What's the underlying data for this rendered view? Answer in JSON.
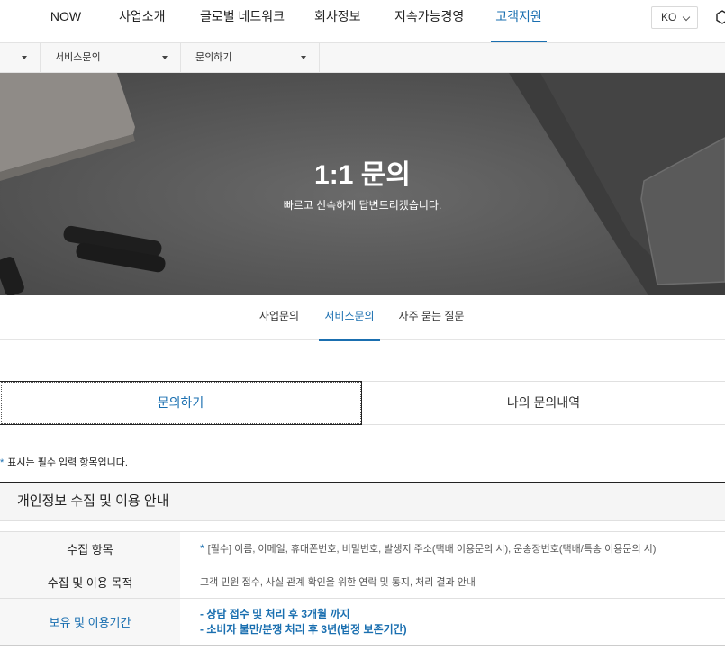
{
  "gnb": {
    "items": [
      {
        "label": "NOW"
      },
      {
        "label": "사업소개"
      },
      {
        "label": "글로벌 네트워크"
      },
      {
        "label": "회사정보"
      },
      {
        "label": "지속가능경영"
      },
      {
        "label": "고객지원"
      }
    ],
    "active_index": 5,
    "lang": "KO"
  },
  "breadcrumb": {
    "items": [
      {
        "label": ""
      },
      {
        "label": "서비스문의"
      },
      {
        "label": "문의하기"
      }
    ]
  },
  "hero": {
    "title": "1:1 문의",
    "subtitle": "빠르고 신속하게 답변드리겠습니다."
  },
  "subtabs": {
    "items": [
      {
        "label": "사업문의"
      },
      {
        "label": "서비스문의"
      },
      {
        "label": "자주 묻는 질문"
      }
    ],
    "active_index": 1
  },
  "bigtabs": {
    "items": [
      {
        "label": "문의하기"
      },
      {
        "label": "나의 문의내역"
      }
    ],
    "active_index": 0
  },
  "required_note": {
    "star": "*",
    "text": "표시는 필수 입력 항목입니다."
  },
  "privacy": {
    "title": "개인정보 수집 및 이용 안내",
    "rows": [
      {
        "label": "수집 항목",
        "star": "*",
        "value": "[필수] 이름, 이메일, 휴대폰번호, 비밀번호, 발생지 주소(택배 이용문의 시), 운송장번호(택배/특송 이용문의 시)"
      },
      {
        "label": "수집 및 이용 목적",
        "value": "고객 민원 접수, 사실 관계 확인을 위한 연락 및 통지, 처리 결과 안내"
      },
      {
        "label": "보유 및 이용기간",
        "lines": [
          "- 상담 접수 및 처리 후 3개월 까지",
          "- 소비자 불만/분쟁 처리 후 3년(법정 보존기간)"
        ]
      }
    ]
  },
  "colors": {
    "accent": "#1a6fb0",
    "hero_bg": "#5d5d5d"
  }
}
